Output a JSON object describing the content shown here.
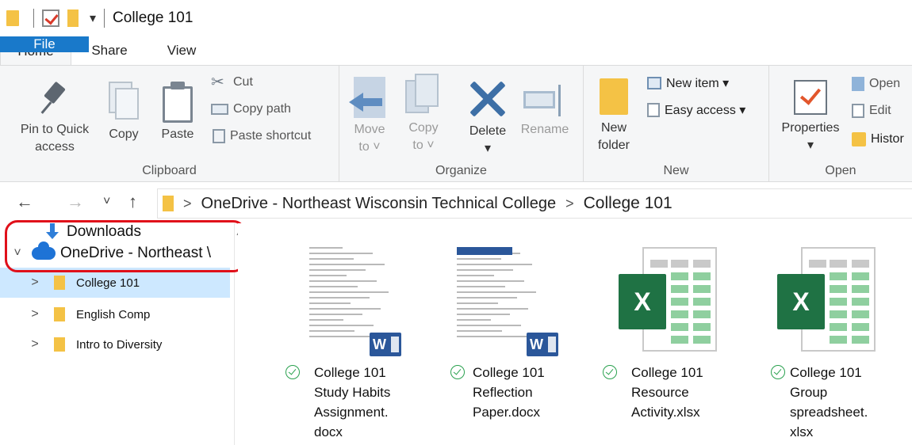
{
  "window": {
    "title": "College 101"
  },
  "tabs": [
    {
      "label": "File"
    },
    {
      "label": "Home"
    },
    {
      "label": "Share"
    },
    {
      "label": "View"
    }
  ],
  "ribbon": {
    "clipboard": {
      "label": "Clipboard",
      "pin_label_1": "Pin to Quick",
      "pin_label_2": "access",
      "copy": "Copy",
      "paste": "Paste",
      "cut": "Cut",
      "copy_path": "Copy path",
      "paste_shortcut": "Paste shortcut"
    },
    "organize": {
      "label": "Organize",
      "move_1": "Move",
      "move_2": "to ˅",
      "copyto_1": "Copy",
      "copyto_2": "to ˅",
      "delete": "Delete",
      "delete_drop": "▾",
      "rename": "Rename"
    },
    "new": {
      "label": "New",
      "new_folder_1": "New",
      "new_folder_2": "folder",
      "new_item": "New item ▾",
      "easy_access": "Easy access ▾"
    },
    "open": {
      "label": "Open",
      "properties": "Properties",
      "properties_drop": "▾",
      "open": "Open",
      "edit": "Edit",
      "history": "Histor"
    }
  },
  "address": {
    "back": "←",
    "forward": "→",
    "recent": "˅",
    "up": "↑",
    "sep": ">",
    "crumbs": [
      "OneDrive - Northeast Wisconsin Technical College",
      "College 101"
    ]
  },
  "nav": {
    "downloads": "Downloads",
    "onedrive": "OneDrive - Northeast \\",
    "expand": "˅",
    "collapsed": ">",
    "folders": [
      "College 101",
      "English Comp",
      "Intro to Diversity"
    ]
  },
  "files": [
    {
      "name_lines": [
        "College 101",
        "Study Habits",
        "Assignment.",
        "docx"
      ],
      "badge": "W"
    },
    {
      "name_lines": [
        "College 101",
        "Reflection",
        "Paper.docx"
      ],
      "badge": "W"
    },
    {
      "name_lines": [
        "College 101",
        "Resource",
        "Activity.xlsx"
      ],
      "badge": "X"
    },
    {
      "name_lines": [
        "College 101",
        "Group",
        "spreadsheet.",
        "xlsx"
      ],
      "badge": "X"
    }
  ]
}
